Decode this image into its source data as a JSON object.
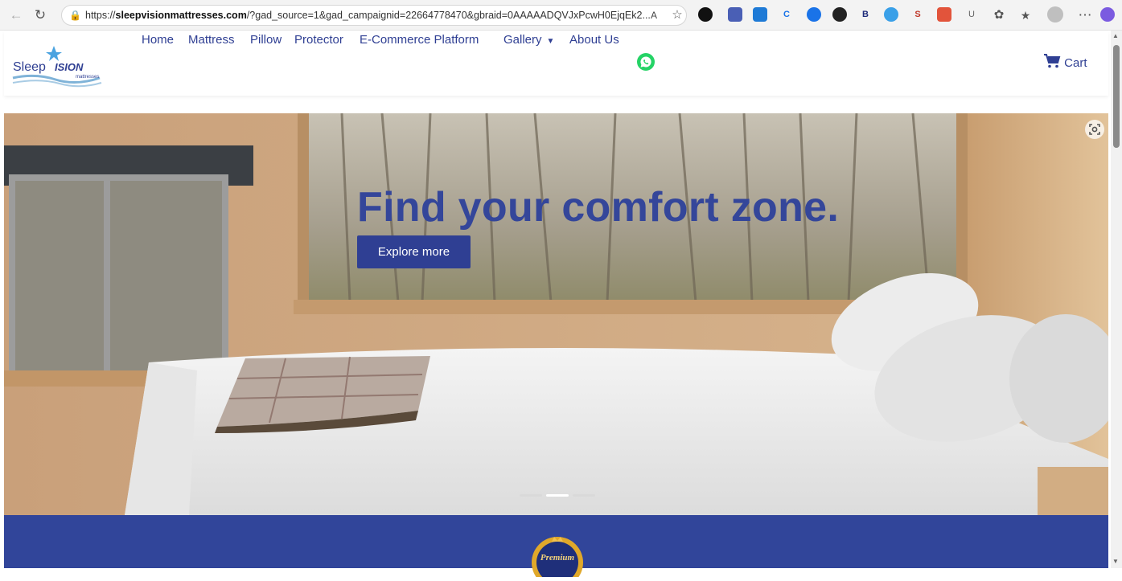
{
  "browser": {
    "url_prefix": "https://",
    "url_domain": "sleepvisionmattresses.com",
    "url_rest": "/?gad_source=1&gad_campaignid=22664778470&gbraid=0AAAAADQVJxPcwH0EjqEk2...",
    "read_aloud": "A",
    "ext_letters": [
      "C",
      "B",
      "S",
      "U"
    ]
  },
  "site": {
    "logo_text_sleep": "Sleep",
    "logo_text_vision": "ISION",
    "logo_sub": "mattresses",
    "nav": {
      "home": "Home",
      "mattress": "Mattress",
      "pillow": "Pillow",
      "protector": "Protector",
      "ecommerce": "E-Commerce Platform",
      "gallery": "Gallery",
      "about": "About Us"
    },
    "cart_label": "Cart"
  },
  "hero": {
    "headline": "Find your comfort zone.",
    "cta": "Explore more",
    "active_slide": 2,
    "slide_count": 3
  },
  "band": {
    "badge_text": "Premium"
  },
  "colors": {
    "brand_blue": "#2f3f93",
    "band_blue": "#31459a",
    "whatsapp": "#25d366"
  }
}
